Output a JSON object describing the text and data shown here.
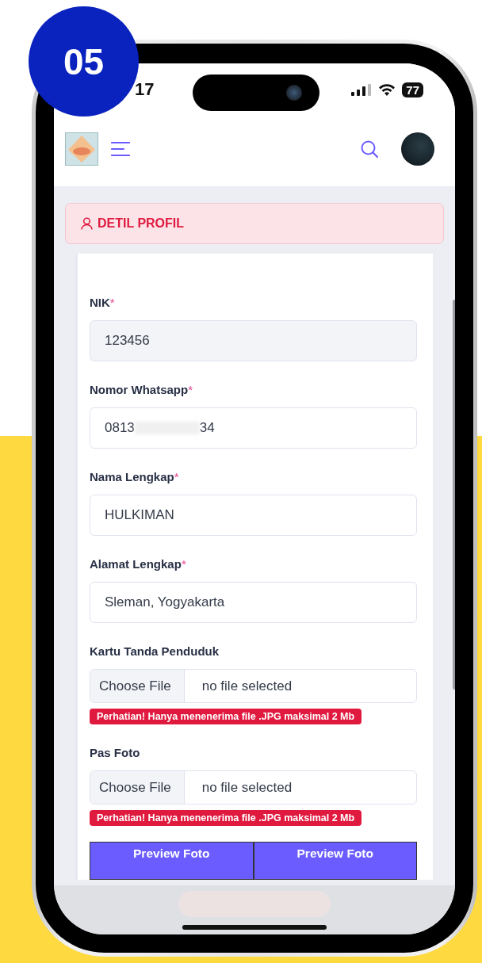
{
  "badge": {
    "text": "05"
  },
  "status_bar": {
    "time": "17",
    "battery": "77"
  },
  "section_title": "DETIL PROFIL",
  "required_mark": "*",
  "fields": [
    {
      "kind": "text",
      "label": "NIK",
      "required": true,
      "disabled": true,
      "value": "123456"
    },
    {
      "kind": "text",
      "label": "Nomor Whatsapp",
      "required": true,
      "disabled": false,
      "value": "0813",
      "redacted": true,
      "value_end": "34"
    },
    {
      "kind": "text",
      "label": "Nama Lengkap",
      "required": true,
      "disabled": false,
      "value": "HULKIMAN"
    },
    {
      "kind": "text",
      "label": "Alamat Lengkap",
      "required": true,
      "disabled": false,
      "value": "Sleman, Yogyakarta"
    },
    {
      "kind": "file",
      "label": "Kartu Tanda Penduduk",
      "required": false,
      "button": "Choose File",
      "status": "no file selected",
      "warning": "Perhatian! Hanya menenerima file .JPG maksimal 2 Mb"
    },
    {
      "kind": "file",
      "label": "Pas Foto",
      "required": false,
      "button": "Choose File",
      "status": "no file selected",
      "warning": "Perhatian! Hanya menenerima file .JPG maksimal 2 Mb"
    }
  ],
  "buttons": [
    {
      "label": "Preview Foto"
    },
    {
      "label": "Preview Foto"
    }
  ]
}
